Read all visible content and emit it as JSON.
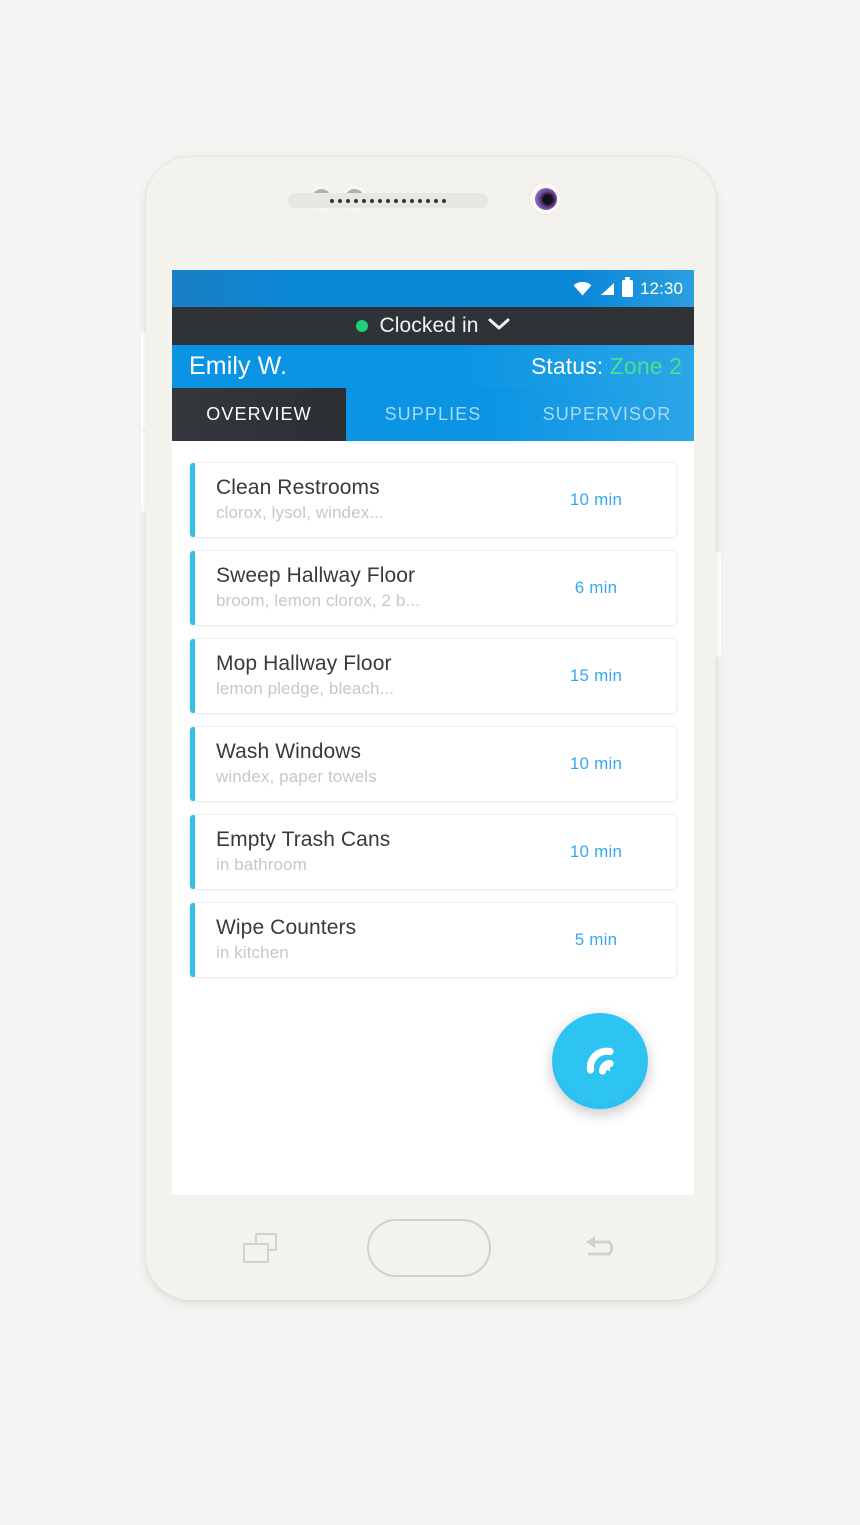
{
  "device": {
    "type": "android-phone",
    "nav": {
      "recent_apps": "recent-apps",
      "home": "home",
      "back": "back"
    }
  },
  "status_bar": {
    "time": "12:30",
    "icons": [
      "wifi-icon",
      "cellular-signal-icon",
      "battery-icon"
    ]
  },
  "clock_status": {
    "label": "Clocked in",
    "indicator_color": "#21d07a",
    "chevron": "chevron-down-icon"
  },
  "header": {
    "user_name": "Emily W.",
    "status_label": "Status:",
    "status_value": "Zone 2",
    "status_value_color": "#4ce08a",
    "background_color": "#0b94e3"
  },
  "tabs": {
    "active_index": 0,
    "items": [
      {
        "label": "OVERVIEW"
      },
      {
        "label": "SUPPLIES"
      },
      {
        "label": "SUPERVISOR"
      }
    ]
  },
  "tasks": [
    {
      "title": "Clean Restrooms",
      "supplies": "clorox, lysol, windex...",
      "duration": "10 min"
    },
    {
      "title": "Sweep Hallway Floor",
      "supplies": "broom, lemon clorox, 2 b...",
      "duration": "6 min"
    },
    {
      "title": "Mop Hallway Floor",
      "supplies": "lemon pledge, bleach...",
      "duration": "15 min"
    },
    {
      "title": "Wash Windows",
      "supplies": "windex, paper towels",
      "duration": "10 min"
    },
    {
      "title": "Empty Trash Cans",
      "supplies": "in bathroom",
      "duration": "10 min"
    },
    {
      "title": "Wipe Counters",
      "supplies": "in kitchen",
      "duration": "5 min"
    }
  ],
  "fab": {
    "icon": "app-logo-signal-icon",
    "color": "#2dc4f2"
  },
  "theme": {
    "accent_blue": "#36c0f0",
    "primary_blue": "#0b94e3",
    "status_bar_blue": "#0b87d8",
    "dark_bar": "#2f3337",
    "duration_blue": "#39a8ec",
    "subtitle_gray": "#c7c7c9"
  }
}
